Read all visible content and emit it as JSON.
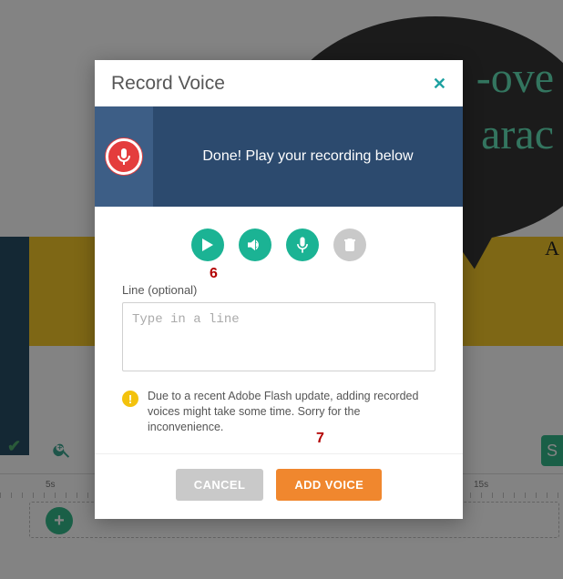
{
  "background": {
    "bubble_line1": "-ove",
    "bubble_line2": "arac",
    "a_letter": "A",
    "timeline": {
      "tick_5s": "5s",
      "tick_15s": "15s"
    }
  },
  "modal": {
    "title": "Record Voice",
    "status_text": "Done! Play your recording below",
    "line_label": "Line (optional)",
    "line_placeholder": "Type in a line",
    "warning_text": "Due to a recent Adobe Flash update, adding recorded voices might take some time. Sorry for the inconvenience.",
    "cancel_label": "CANCEL",
    "add_label": "ADD VOICE"
  },
  "callouts": {
    "play": "6",
    "add": "7"
  },
  "icons": {
    "close": "✕",
    "zoom": "⊕",
    "check": "✔",
    "add": "+",
    "save_stub": "S",
    "warn": "!"
  }
}
